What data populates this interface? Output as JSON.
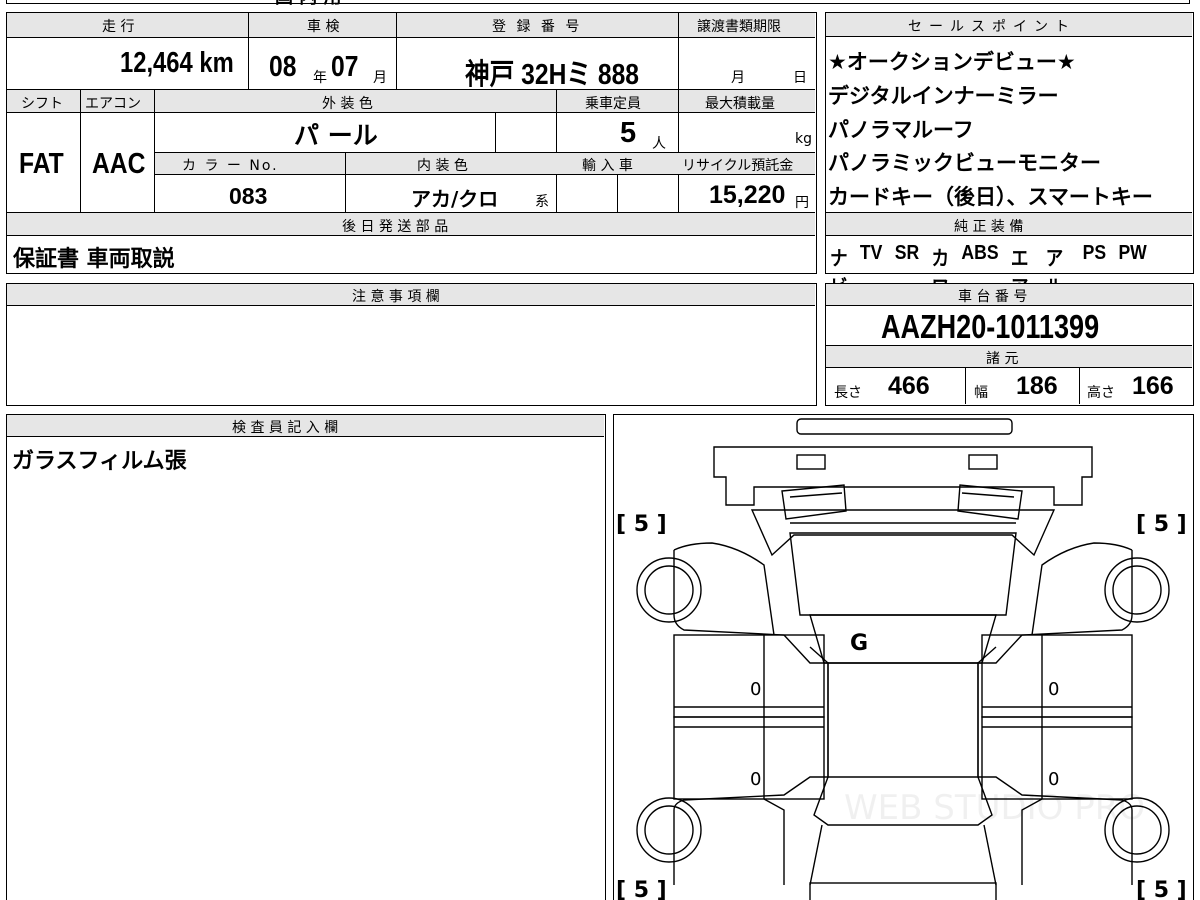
{
  "top_strip": {
    "cut_text": "国 内 用"
  },
  "vehicle": {
    "h_mileage": "走 行",
    "h_inspection": "車 検",
    "h_registration": "登 録 番 号",
    "h_transfer_deadline": "譲渡書類期限",
    "mileage": "12,464 km",
    "inspection_year": "08",
    "inspection_year_unit": "年",
    "inspection_month": "07",
    "inspection_month_unit": "月",
    "registration": "神戸 32Hミ 888",
    "deadline_month_unit": "月",
    "deadline_day_unit": "日",
    "h_shift": "シフト",
    "h_aircon": "エアコン",
    "h_exterior_color": "外 装 色",
    "h_capacity": "乗車定員",
    "h_max_load": "最大積載量",
    "shift": "FAT",
    "aircon": "AAC",
    "exterior_color": "パ ール",
    "capacity": "5",
    "capacity_unit": "人",
    "load_unit": "kg",
    "h_color_no": "カ ラ ー No.",
    "h_interior_color": "内 装 色",
    "h_import": "輸 入 車",
    "h_recycle": "リサイクル預託金",
    "color_no": "083",
    "interior_color": "アカ/クロ",
    "interior_suffix": "系",
    "recycle_fee": "15,220",
    "recycle_unit": "円"
  },
  "later_parts": {
    "header": "後 日 発 送 部 品",
    "text": "保証書 車両取説"
  },
  "sales_points": {
    "header": "セールスポイント",
    "items": [
      "★オークションデビュー★",
      "デジタルインナーミラー",
      "パノラマルーフ",
      "パノラミックビューモニター",
      "カードキー（後日）、スマートキー"
    ]
  },
  "equipment": {
    "header": "純 正 装 備",
    "items": [
      "ナビ",
      "TV",
      "SR",
      "カワ",
      "ABS",
      "エアB",
      "アルミ",
      "PS",
      "PW"
    ]
  },
  "notes": {
    "header": "注 意 事 項 欄",
    "text": ""
  },
  "chassis": {
    "header": "車 台 番 号",
    "number": "AAZH20-1011399"
  },
  "specs": {
    "header": "諸 元",
    "length_label": "長さ",
    "length": "466",
    "width_label": "幅",
    "width": "186",
    "height_label": "高さ",
    "height": "166"
  },
  "inspector": {
    "header": "検 査 員 記 入 欄",
    "text": "ガラスフィルム張"
  },
  "diagram": {
    "front_left_tire": "[ 5 ]",
    "front_right_tire": "[ 5 ]",
    "rear_left_tire": "[ 5 ]",
    "rear_right_tire": "[ 5 ]",
    "roof_mark": "G",
    "left_front_door": "0",
    "left_rear_door": "0",
    "right_front_door": "0",
    "right_rear_door": "0",
    "watermark": "WEB STUDIO PRO"
  }
}
